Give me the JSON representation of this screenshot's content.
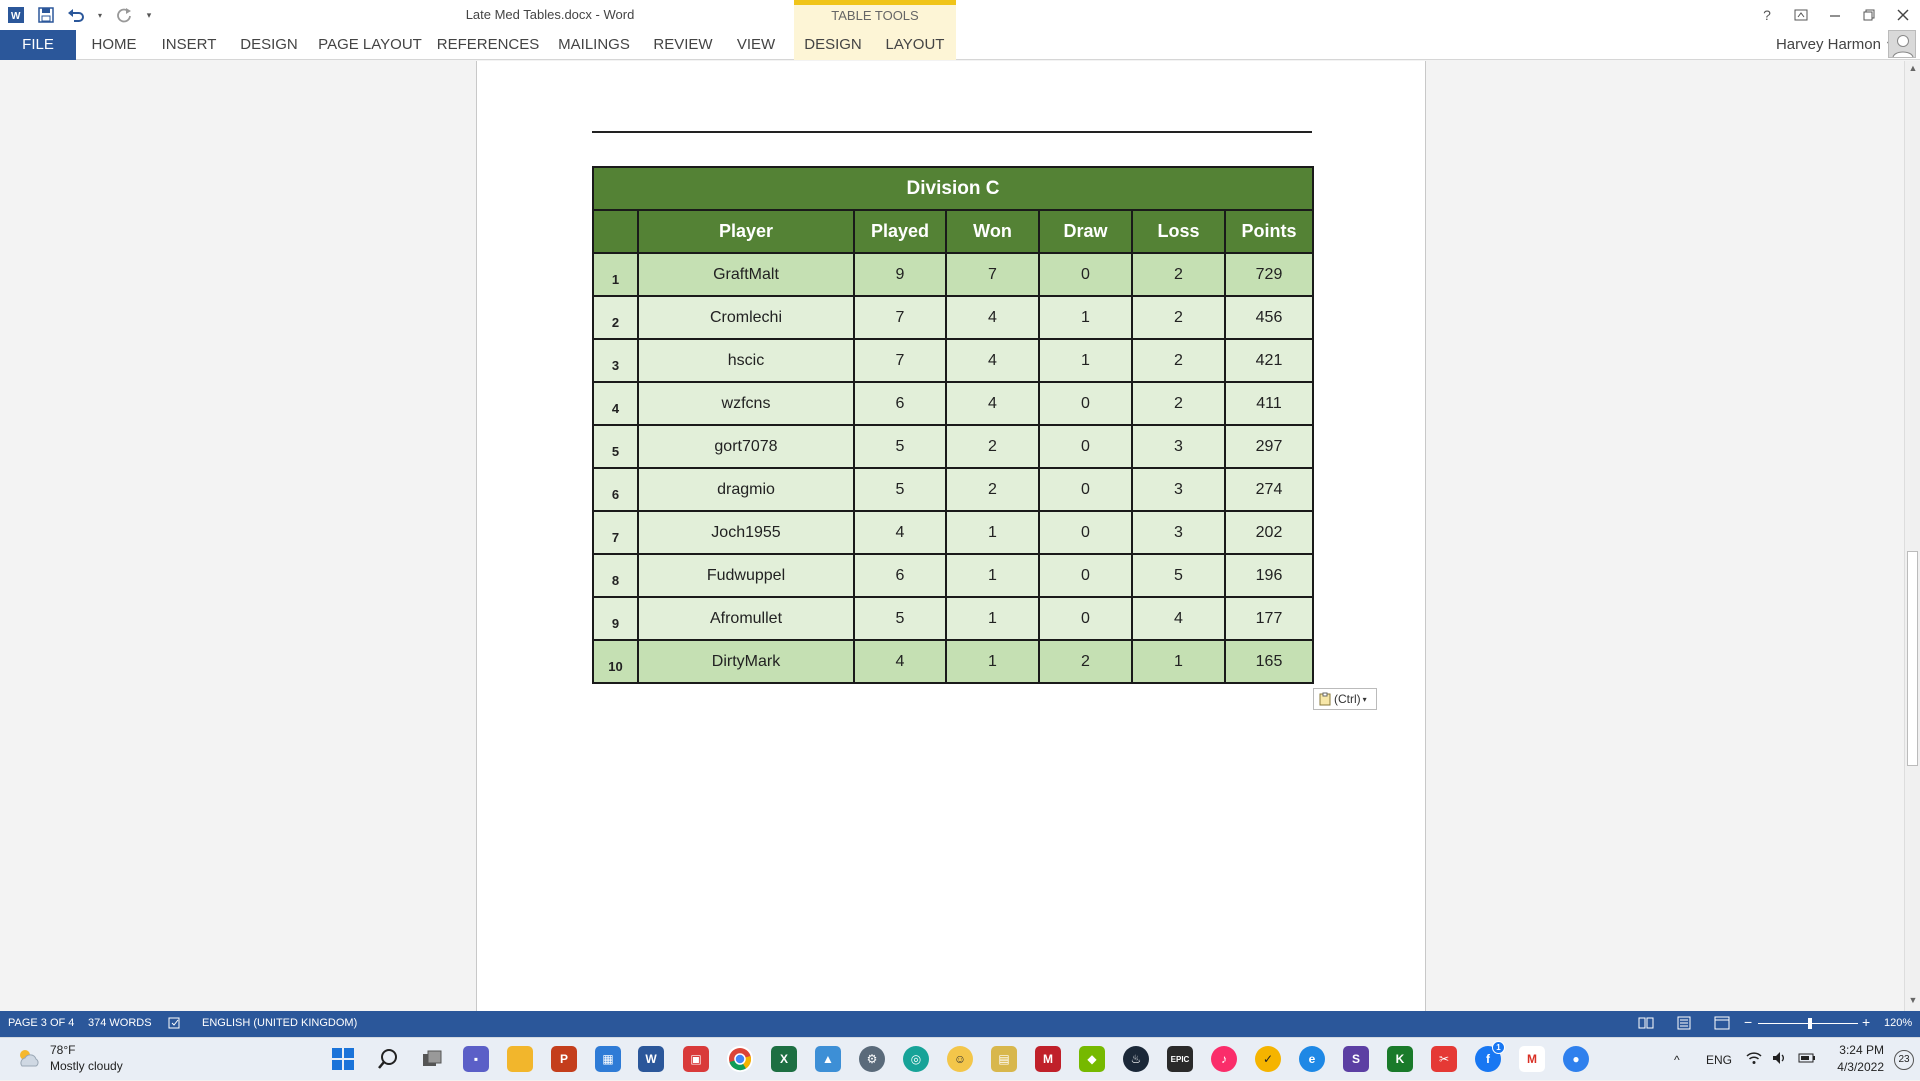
{
  "window": {
    "title": "Late Med Tables.docx - Word",
    "contextual_group": "TABLE TOOLS",
    "user_name": "Harvey Harmon"
  },
  "ribbon": {
    "tabs": [
      {
        "label": "FILE"
      },
      {
        "label": "HOME"
      },
      {
        "label": "INSERT"
      },
      {
        "label": "DESIGN"
      },
      {
        "label": "PAGE LAYOUT"
      },
      {
        "label": "REFERENCES"
      },
      {
        "label": "MAILINGS"
      },
      {
        "label": "REVIEW"
      },
      {
        "label": "VIEW"
      },
      {
        "label": "DESIGN"
      },
      {
        "label": "LAYOUT"
      }
    ]
  },
  "document": {
    "table": {
      "caption": "Division C",
      "headers": [
        "",
        "Player",
        "Played",
        "Won",
        "Draw",
        "Loss",
        "Points"
      ],
      "rows": [
        {
          "rank": "1",
          "player": "GraftMalt",
          "played": "9",
          "won": "7",
          "draw": "0",
          "loss": "2",
          "points": "729"
        },
        {
          "rank": "2",
          "player": "Cromlechi",
          "played": "7",
          "won": "4",
          "draw": "1",
          "loss": "2",
          "points": "456"
        },
        {
          "rank": "3",
          "player": "hscic",
          "played": "7",
          "won": "4",
          "draw": "1",
          "loss": "2",
          "points": "421"
        },
        {
          "rank": "4",
          "player": "wzfcns",
          "played": "6",
          "won": "4",
          "draw": "0",
          "loss": "2",
          "points": "411"
        },
        {
          "rank": "5",
          "player": "gort7078",
          "played": "5",
          "won": "2",
          "draw": "0",
          "loss": "3",
          "points": "297"
        },
        {
          "rank": "6",
          "player": "dragmio",
          "played": "5",
          "won": "2",
          "draw": "0",
          "loss": "3",
          "points": "274"
        },
        {
          "rank": "7",
          "player": "Joch1955",
          "played": "4",
          "won": "1",
          "draw": "0",
          "loss": "3",
          "points": "202"
        },
        {
          "rank": "8",
          "player": "Fudwuppel",
          "played": "6",
          "won": "1",
          "draw": "0",
          "loss": "5",
          "points": "196"
        },
        {
          "rank": "9",
          "player": "Afromullet",
          "played": "5",
          "won": "1",
          "draw": "0",
          "loss": "4",
          "points": "177"
        },
        {
          "rank": "10",
          "player": "DirtyMark",
          "played": "4",
          "won": "1",
          "draw": "2",
          "loss": "1",
          "points": "165"
        }
      ]
    },
    "paste_options_label": "(Ctrl)"
  },
  "statusbar": {
    "page": "PAGE 3 OF 4",
    "words": "374 WORDS",
    "language": "ENGLISH (UNITED KINGDOM)",
    "zoom": "120%"
  },
  "taskbar": {
    "weather_temp": "78°F",
    "weather_desc": "Mostly cloudy",
    "language": "ENG",
    "time": "3:24 PM",
    "date": "4/3/2022",
    "notification_count": "23",
    "facebook_badge": "1"
  },
  "colors": {
    "word_blue": "#2b579a",
    "table_header_green": "#548235",
    "table_light_green": "#e2efd9",
    "table_mid_green": "#c5e0b3",
    "table_tools_yellow": "#f0c419"
  }
}
